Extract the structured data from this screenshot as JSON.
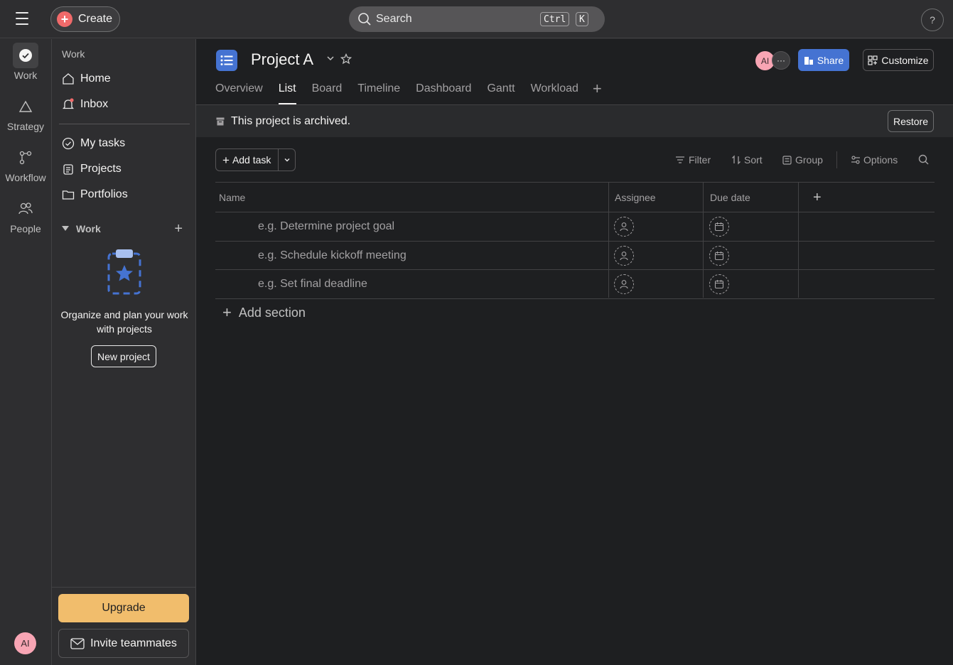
{
  "topbar": {
    "create_label": "Create",
    "search_label": "Search",
    "shortcut_ctrl": "Ctrl",
    "shortcut_k": "K",
    "help_label": "?"
  },
  "rail": {
    "items": [
      {
        "label": "Work"
      },
      {
        "label": "Strategy"
      },
      {
        "label": "Workflow"
      },
      {
        "label": "People"
      }
    ],
    "avatar_initials": "AI"
  },
  "sidebar": {
    "heading": "Work",
    "items": [
      {
        "label": "Home"
      },
      {
        "label": "Inbox"
      },
      {
        "label": "My tasks"
      },
      {
        "label": "Projects"
      },
      {
        "label": "Portfolios"
      }
    ],
    "work_section_label": "Work",
    "promo_text": "Organize and plan your work with projects",
    "new_project_label": "New project",
    "upgrade_label": "Upgrade",
    "invite_label": "Invite teammates"
  },
  "project": {
    "title": "Project A",
    "tabs": [
      {
        "label": "Overview"
      },
      {
        "label": "List"
      },
      {
        "label": "Board"
      },
      {
        "label": "Timeline"
      },
      {
        "label": "Dashboard"
      },
      {
        "label": "Gantt"
      },
      {
        "label": "Workload"
      }
    ],
    "active_tab": "List",
    "member_avatar": "AI",
    "share_label": "Share",
    "customize_label": "Customize",
    "archived_notice": "This project is archived.",
    "restore_label": "Restore"
  },
  "toolbar": {
    "add_task_label": "Add task",
    "filter_label": "Filter",
    "sort_label": "Sort",
    "group_label": "Group",
    "options_label": "Options"
  },
  "table": {
    "columns": [
      "Name",
      "Assignee",
      "Due date"
    ],
    "rows": [
      {
        "name": "e.g. Determine project goal"
      },
      {
        "name": "e.g. Schedule kickoff meeting"
      },
      {
        "name": "e.g. Set final deadline"
      }
    ],
    "add_section_label": "Add section"
  },
  "colors": {
    "accent": "#4573d2",
    "create": "#f06a6a",
    "upgrade": "#f1bd6c",
    "avatar": "#f8a5b4"
  }
}
